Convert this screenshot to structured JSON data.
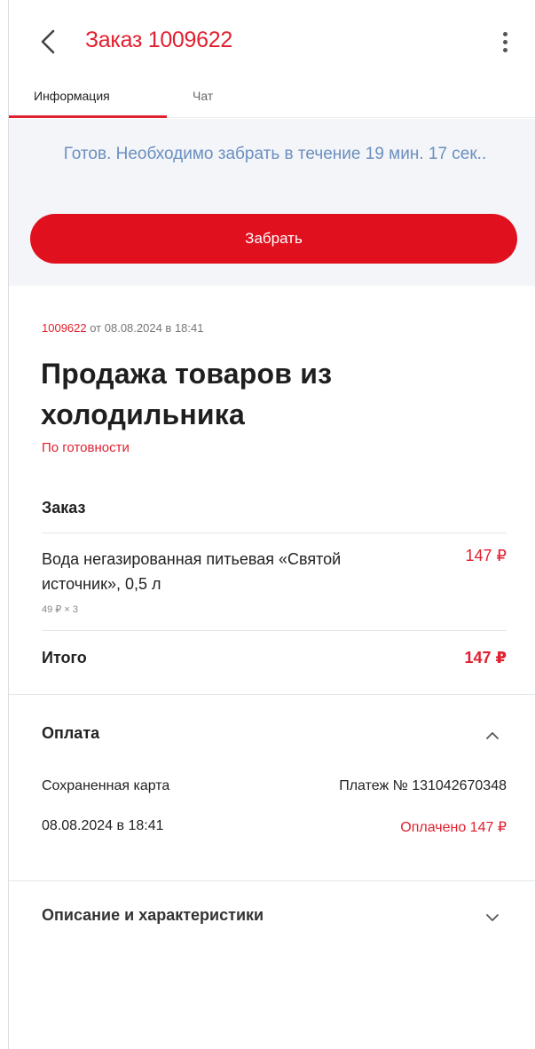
{
  "header": {
    "title": "Заказ 1009622"
  },
  "tabs": [
    {
      "label": "Информация",
      "active": true
    },
    {
      "label": "Чат",
      "active": false
    }
  ],
  "status": {
    "message": "Готов. Необходимо забрать в течение 19 мин. 17 сек..",
    "action_label": "Забрать"
  },
  "order": {
    "number": "1009622",
    "date_text": " от 08.08.2024 в 18:41",
    "title": "Продажа товаров из холодильника",
    "readiness": "По готовности",
    "section_label": "Заказ",
    "items": [
      {
        "name": "Вода негазированная питьевая «Святой источник», 0,5 л",
        "price": "147 ₽",
        "qty": "49 ₽ × 3"
      }
    ],
    "total_label": "Итого",
    "total_value": "147 ₽"
  },
  "payment": {
    "section_label": "Оплата",
    "method": "Сохраненная карта",
    "payment_id": "Платеж № 131042670348",
    "datetime": "08.08.2024 в 18:41",
    "status": "Оплачено 147 ₽"
  },
  "description": {
    "section_label": "Описание и характеристики"
  },
  "colors": {
    "accent": "#e0202f",
    "status_text": "#6b8fc0",
    "status_bg": "#f3f5f8"
  },
  "icons": {
    "back": "chevron-left-icon",
    "more": "more-vertical-icon",
    "payment_toggle": "chevron-up-icon",
    "description_toggle": "chevron-down-icon"
  }
}
